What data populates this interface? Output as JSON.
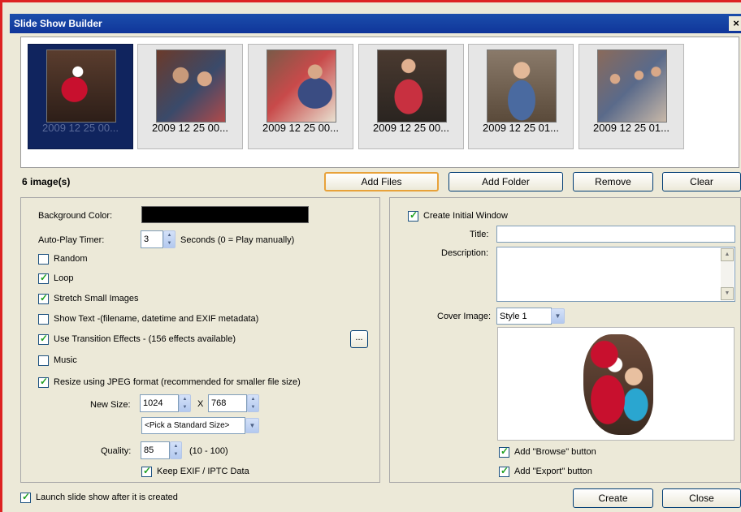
{
  "window": {
    "title": "Slide Show Builder",
    "close_glyph": "×"
  },
  "gallery": {
    "items": [
      {
        "label": "2009 12 25 00...",
        "selected": true
      },
      {
        "label": "2009 12 25 00...",
        "selected": false
      },
      {
        "label": "2009 12 25 00...",
        "selected": false
      },
      {
        "label": "2009 12 25 00...",
        "selected": false
      },
      {
        "label": "2009 12 25 01...",
        "selected": false
      },
      {
        "label": "2009 12 25 01...",
        "selected": false
      }
    ],
    "count_text": "6 image(s)"
  },
  "toolbar": {
    "add_files": "Add Files",
    "add_folder": "Add Folder",
    "remove": "Remove",
    "clear": "Clear"
  },
  "settings": {
    "background_color_label": "Background Color:",
    "background_color": "#000000",
    "autoplay_label": "Auto-Play Timer:",
    "autoplay_value": "3",
    "autoplay_hint": "Seconds (0 = Play  manually)",
    "random": {
      "label": "Random",
      "checked": false
    },
    "loop": {
      "label": "Loop",
      "checked": true
    },
    "stretch": {
      "label": "Stretch Small Images",
      "checked": true
    },
    "show_text": {
      "label": "Show Text -(filename, datetime and EXIF metadata)",
      "checked": false
    },
    "transitions": {
      "label": "Use Transition Effects   -    (156 effects available)",
      "checked": true
    },
    "transitions_more": "...",
    "music": {
      "label": "Music",
      "checked": false
    },
    "resize": {
      "label": "Resize using JPEG format (recommended for smaller file size)",
      "checked": true
    },
    "new_size_label": "New Size:",
    "width_value": "1024",
    "size_sep": "X",
    "height_value": "768",
    "standard_size": "<Pick a Standard Size>",
    "quality_label": "Quality:",
    "quality_value": "85",
    "quality_hint": "(10 - 100)",
    "keep_exif": {
      "label": "Keep EXIF / IPTC Data",
      "checked": true
    }
  },
  "initial_window": {
    "create": {
      "label": "Create Initial Window",
      "checked": true
    },
    "title_label": "Title:",
    "title_value": "",
    "description_label": "Description:",
    "description_value": "",
    "cover_label": "Cover Image:",
    "cover_value": "Style 1",
    "browse_btn": {
      "label": "Add \"Browse\" button",
      "checked": true
    },
    "export_btn": {
      "label": "Add \"Export\" button",
      "checked": true
    }
  },
  "footer": {
    "launch": {
      "label": "Launch slide show after it is created",
      "checked": true
    },
    "create": "Create",
    "close": "Close"
  }
}
